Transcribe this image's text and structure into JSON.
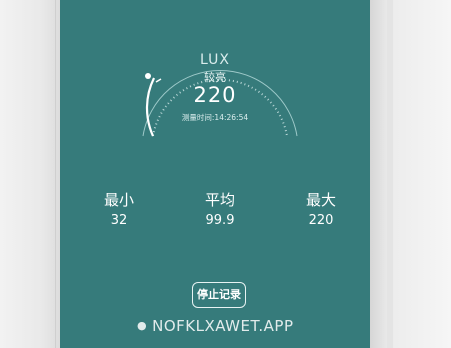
{
  "reading": {
    "unit": "LUX",
    "level": "较亮",
    "value": "220",
    "time_label": "测量时间:",
    "time_value": "14:26:54"
  },
  "stats": [
    {
      "label": "最小",
      "value": "32"
    },
    {
      "label": "平均",
      "value": "99.9"
    },
    {
      "label": "最大",
      "value": "220"
    }
  ],
  "stop_button": {
    "label": "停止记录"
  },
  "watermark": {
    "text": "NOFKLXAWET.APP"
  },
  "colors": {
    "screen": "#367b7b",
    "text": "#ffffff"
  },
  "icons": {
    "watermark_bullet": "bullet-icon"
  }
}
